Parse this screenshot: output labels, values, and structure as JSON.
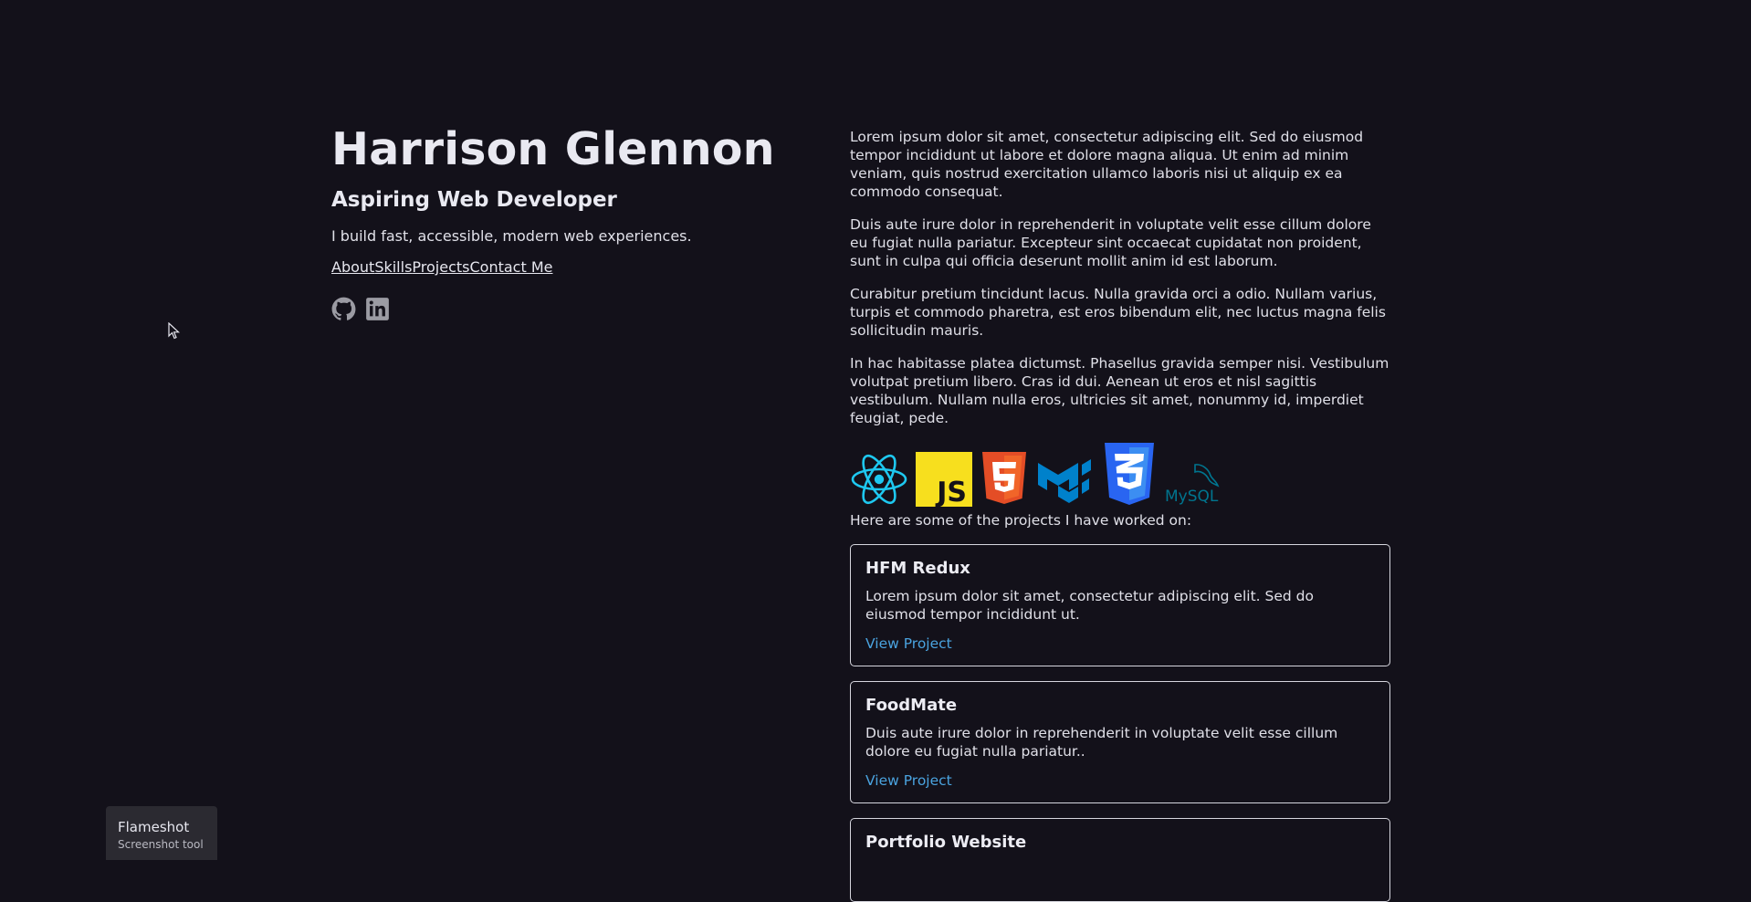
{
  "header": {
    "name": "Harrison Glennon",
    "role": "Aspiring Web Developer",
    "tagline": "I build fast, accessible, modern web experiences."
  },
  "nav": [
    "About",
    "Skills",
    "Projects",
    "Contact Me"
  ],
  "social": [
    "github-icon",
    "linkedin-icon"
  ],
  "about": [
    "Lorem ipsum dolor sit amet, consectetur adipiscing elit. Sed do eiusmod tempor incididunt ut labore et dolore magna aliqua. Ut enim ad minim veniam, quis nostrud exercitation ullamco laboris nisi ut aliquip ex ea commodo consequat.",
    "Duis aute irure dolor in reprehenderit in voluptate velit esse cillum dolore eu fugiat nulla pariatur. Excepteur sint occaecat cupidatat non proident, sunt in culpa qui officia deserunt mollit anim id est laborum.",
    "Curabitur pretium tincidunt lacus. Nulla gravida orci a odio. Nullam varius, turpis et commodo pharetra, est eros bibendum elit, nec luctus magna felis sollicitudin mauris.",
    "In hac habitasse platea dictumst. Phasellus gravida semper nisi. Vestibulum volutpat pretium libero. Cras id dui. Aenean ut eros et nisl sagittis vestibulum. Nullam nulla eros, ultricies sit amet, nonummy id, imperdiet feugiat, pede."
  ],
  "skills": {
    "icons": [
      "react-icon",
      "javascript-icon",
      "html5-icon",
      "material-ui-icon",
      "css3-icon",
      "mysql-icon"
    ],
    "js_text": "JS",
    "mysql_text": "MySQL"
  },
  "projects_intro": "Here are some of the projects I have worked on:",
  "projects": [
    {
      "title": "HFM Redux",
      "desc": "Lorem ipsum dolor sit amet, consectetur adipiscing elit. Sed do eiusmod tempor incididunt ut.",
      "link": "View Project"
    },
    {
      "title": "FoodMate",
      "desc": "Duis aute irure dolor in reprehenderit in voluptate velit esse cillum dolore eu fugiat nulla pariatur..",
      "link": "View Project"
    },
    {
      "title": "Portfolio Website"
    }
  ],
  "toast": {
    "title": "Flameshot",
    "subtitle": "Screenshot tool"
  },
  "colors": {
    "background": "#13111a",
    "link": "#4aa3df",
    "react": "#1ec8f0",
    "js": "#f7df1e",
    "html5": "#e44d26",
    "css3": "#2965f1",
    "mui": "#0081cb",
    "mysql": "#00758f"
  }
}
